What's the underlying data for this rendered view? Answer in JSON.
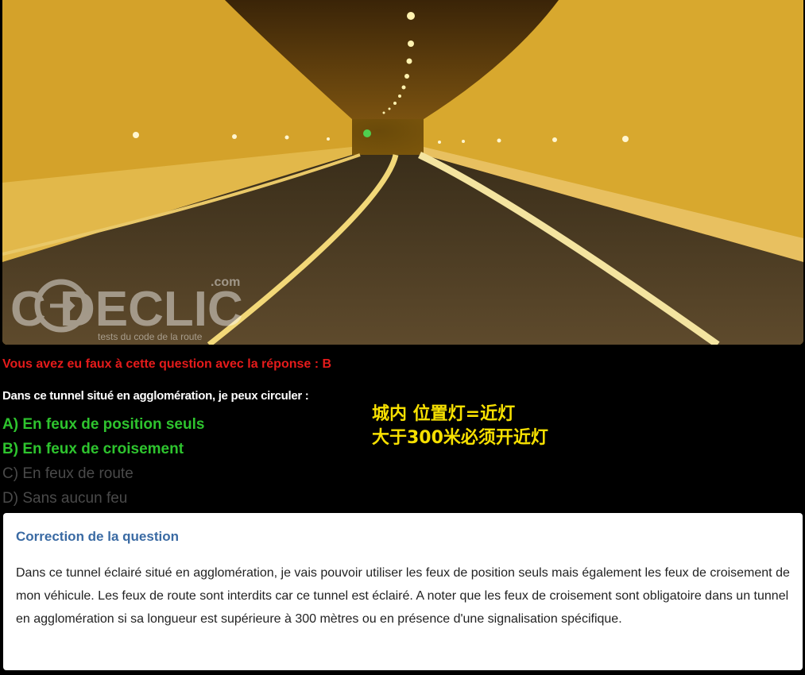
{
  "photo": {
    "alt": "Route dans un tunnel éclairé",
    "watermark": {
      "brand": "C DECLIC",
      "domain": ".com",
      "tagline": "tests du code de la route"
    }
  },
  "result": {
    "text": "Vous avez eu faux à cette question avec la réponse : B",
    "color": "#e51b1b"
  },
  "question": {
    "text": "Dans ce tunnel situé en agglomération, je peux circuler :"
  },
  "answers": [
    {
      "text": "A) En feux de position seuls",
      "status": "correct"
    },
    {
      "text": "B) En feux de croisement",
      "status": "correct"
    },
    {
      "text": "C) En feux de route",
      "status": "wrong"
    },
    {
      "text": "D) Sans aucun feu",
      "status": "wrong"
    }
  ],
  "note": {
    "line1": "城内 位置灯=近灯",
    "line2": "大于300米必须开近灯",
    "color": "#f7e000"
  },
  "correction": {
    "title": "Correction de la question",
    "body": "Dans ce tunnel éclairé situé en agglomération, je vais pouvoir utiliser les feux de position seuls mais également les feux de croisement de mon véhicule. Les feux de route sont interdits car ce tunnel est éclairé. A noter que les feux de croisement sont obligatoire dans un tunnel en agglomération si sa longueur est supérieure à 300 mètres ou en présence d'une signalisation spécifique."
  }
}
